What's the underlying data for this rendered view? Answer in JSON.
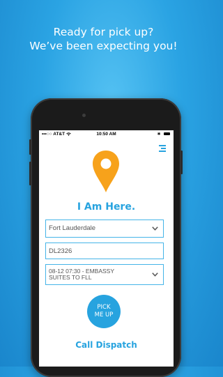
{
  "headline": {
    "line1": "Ready for pick up?",
    "line2": "We’ve been expecting you!"
  },
  "status_bar": {
    "carrier": "•••○○ AT&T",
    "time": "10:50 AM",
    "bluetooth": "∗"
  },
  "app": {
    "title": "I Am Here.",
    "city_select": "Fort Lauderdale",
    "flight_field": "DL2326",
    "reservation_line1": "08-12 07:30 - EMBASSY",
    "reservation_line2": "SUITES to FLL",
    "pick_line1": "PICK",
    "pick_line2": "ME UP",
    "call_dispatch": "Call Dispatch"
  },
  "colors": {
    "accent": "#27a3df",
    "pin": "#f7a21b",
    "background": "#2aa3e3"
  },
  "icons": [
    "location-pin-icon",
    "menu-icon",
    "chevron-down-icon",
    "wifi-icon",
    "battery-icon"
  ]
}
